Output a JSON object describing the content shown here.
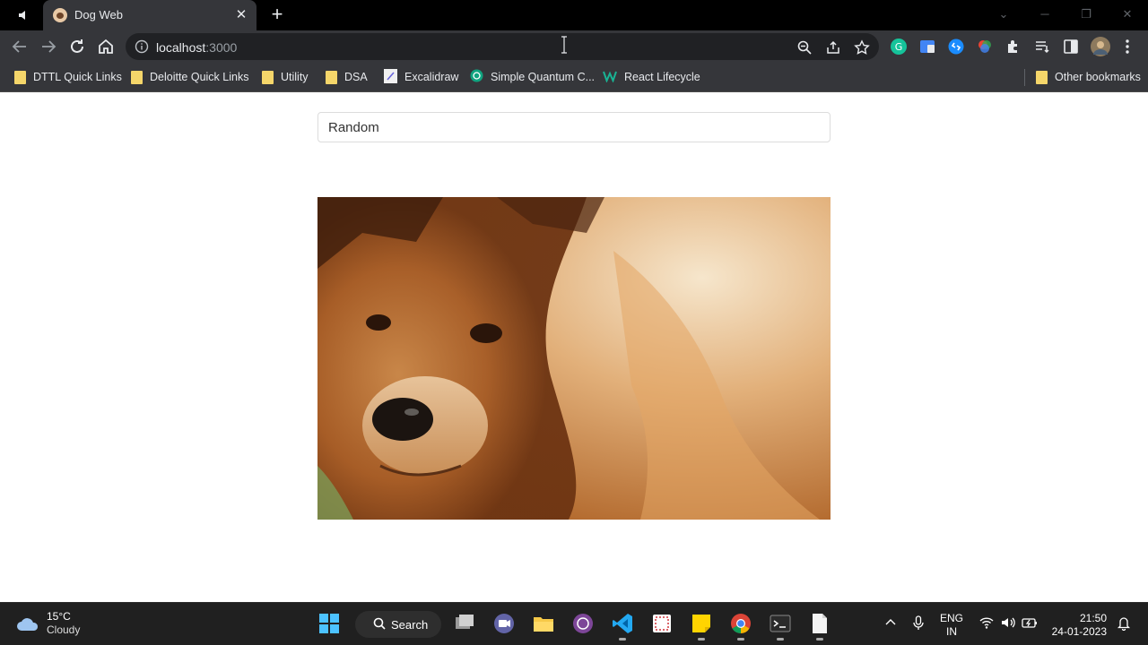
{
  "browser": {
    "tab": {
      "title": "Dog Web"
    },
    "address": {
      "host": "localhost",
      "port": ":3000"
    }
  },
  "bookmarks": [
    {
      "label": "DTTL Quick Links",
      "icon": "folder-icon"
    },
    {
      "label": "Deloitte Quick Links",
      "icon": "folder-icon"
    },
    {
      "label": "Utility",
      "icon": "folder-icon"
    },
    {
      "label": "DSA",
      "icon": "folder-icon"
    },
    {
      "label": "Excalidraw",
      "icon": "excalidraw-icon"
    },
    {
      "label": "Simple Quantum C...",
      "icon": "openai-icon"
    },
    {
      "label": "React Lifecycle",
      "icon": "w-icon"
    }
  ],
  "other_bookmarks": "Other bookmarks",
  "page": {
    "select_value": "Random",
    "photo_alt": "chow chow dog photo"
  },
  "taskbar": {
    "weather": {
      "temp": "15°C",
      "condition": "Cloudy"
    },
    "search_label": "Search",
    "lang": {
      "line1": "ENG",
      "line2": "IN"
    },
    "clock": {
      "time": "21:50",
      "date": "24-01-2023"
    }
  },
  "colors": {
    "accent_blue": "#1a73e8",
    "tab_bg": "#35363a",
    "frame": "#000000"
  }
}
